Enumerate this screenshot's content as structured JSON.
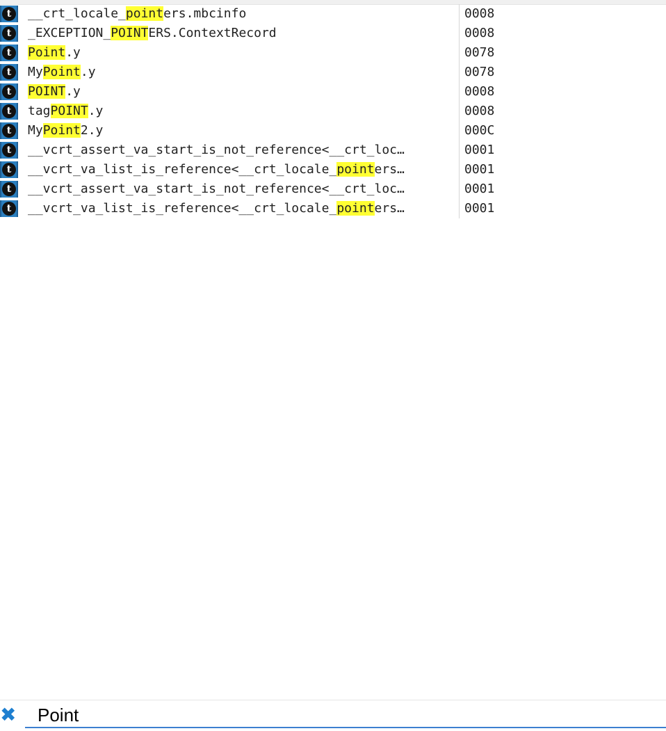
{
  "rows": [
    {
      "name_parts": [
        {
          "t": "__crt_locale_",
          "h": false
        },
        {
          "t": "point",
          "h": true
        },
        {
          "t": "ers.mbcinfo",
          "h": false
        }
      ],
      "offset": "0008"
    },
    {
      "name_parts": [
        {
          "t": "_EXCEPTION_",
          "h": false
        },
        {
          "t": "POINT",
          "h": true
        },
        {
          "t": "ERS.ContextRecord",
          "h": false
        }
      ],
      "offset": "0008"
    },
    {
      "name_parts": [
        {
          "t": "Point",
          "h": true
        },
        {
          "t": ".y",
          "h": false
        }
      ],
      "offset": "0078"
    },
    {
      "name_parts": [
        {
          "t": "My",
          "h": false
        },
        {
          "t": "Point",
          "h": true
        },
        {
          "t": ".y",
          "h": false
        }
      ],
      "offset": "0078"
    },
    {
      "name_parts": [
        {
          "t": "POINT",
          "h": true
        },
        {
          "t": ".y",
          "h": false
        }
      ],
      "offset": "0008"
    },
    {
      "name_parts": [
        {
          "t": "tag",
          "h": false
        },
        {
          "t": "POINT",
          "h": true
        },
        {
          "t": ".y",
          "h": false
        }
      ],
      "offset": "0008"
    },
    {
      "name_parts": [
        {
          "t": "My",
          "h": false
        },
        {
          "t": "Point",
          "h": true
        },
        {
          "t": "2.y",
          "h": false
        }
      ],
      "offset": "000C"
    },
    {
      "name_parts": [
        {
          "t": "__vcrt_assert_va_start_is_not_reference<__crt_loc…",
          "h": false
        }
      ],
      "offset": "0001"
    },
    {
      "name_parts": [
        {
          "t": "__vcrt_va_list_is_reference<__crt_locale_",
          "h": false
        },
        {
          "t": "point",
          "h": true
        },
        {
          "t": "ers…",
          "h": false
        }
      ],
      "offset": "0001"
    },
    {
      "name_parts": [
        {
          "t": "__vcrt_assert_va_start_is_not_reference<__crt_loc…",
          "h": false
        }
      ],
      "offset": "0001"
    },
    {
      "name_parts": [
        {
          "t": "__vcrt_va_list_is_reference<__crt_locale_",
          "h": false
        },
        {
          "t": "point",
          "h": true
        },
        {
          "t": "ers…",
          "h": false
        }
      ],
      "offset": "0001"
    }
  ],
  "row_icon": {
    "name": "type-icon",
    "glyph": "t"
  },
  "search": {
    "value": "Point",
    "close_icon": "close-icon",
    "close_glyph": "✖"
  },
  "colors": {
    "highlight": "#ffff33",
    "icon_bg": "#2b7fbf",
    "accent": "#3c7fd0"
  }
}
